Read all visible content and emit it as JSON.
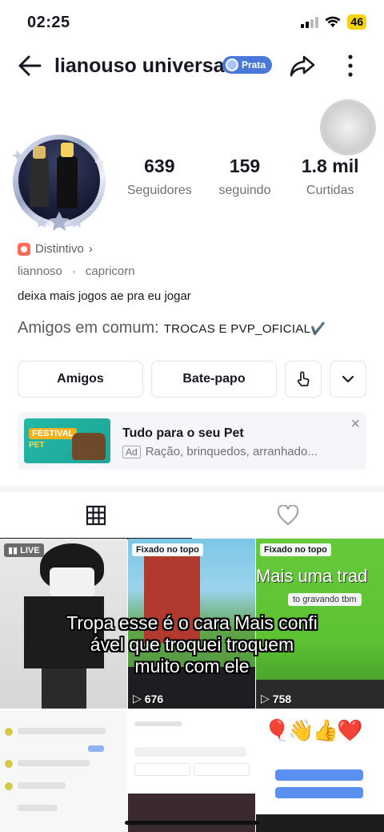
{
  "status_bar": {
    "time": "02:25",
    "battery": "46"
  },
  "header": {
    "username": "lianouso universal",
    "tier_label": "Prata"
  },
  "stats": [
    {
      "value": "639",
      "label": "Seguidores"
    },
    {
      "value": "159",
      "label": "seguindo"
    },
    {
      "value": "1.8 mil",
      "label": "Curtidas"
    }
  ],
  "profile": {
    "badge_label": "Distintivo",
    "handle": "liannoso",
    "sign": "capricorn",
    "bio": "deixa mais jogos ae pra eu jogar",
    "mutual_label": "Amigos em comum:",
    "mutual_names": "TROCAS E PVP_OFICIAL✔️"
  },
  "actions": {
    "friends": "Amigos",
    "chat": "Bate-papo"
  },
  "ad": {
    "title": "Tudo para o seu Pet",
    "tag": "Ad",
    "description": "Ração, brinquedos, arranhado...",
    "thumb_label": "FESTIVAL",
    "thumb_sub": "PET"
  },
  "grid": {
    "live_label": "LIVE",
    "pinned_label": "Fixado no topo",
    "views": [
      "676",
      "758"
    ],
    "overlay_texts": [
      "Mais uma trad",
      "to gravando tbm"
    ],
    "caption_lines": [
      "Tropa esse é o cara Mais confi",
      "ável que troquei troquem",
      "muito com ele"
    ]
  },
  "colors": {
    "accent_blue": "#4a78d8",
    "badge_red": "#ff6b5b",
    "ad_bg": "#f4f6fa"
  }
}
